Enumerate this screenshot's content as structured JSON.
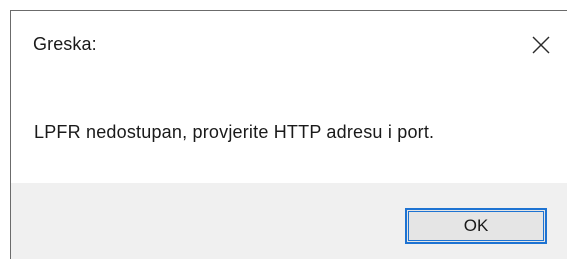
{
  "dialog": {
    "title": "Greska:",
    "message": "LPFR nedostupan, provjerite HTTP adresu i port.",
    "ok_label": "OK",
    "close_icon": "close-icon"
  },
  "colors": {
    "accent": "#1e73d2",
    "footer_background": "#f0f0f0",
    "button_background": "#e5e5e5"
  }
}
